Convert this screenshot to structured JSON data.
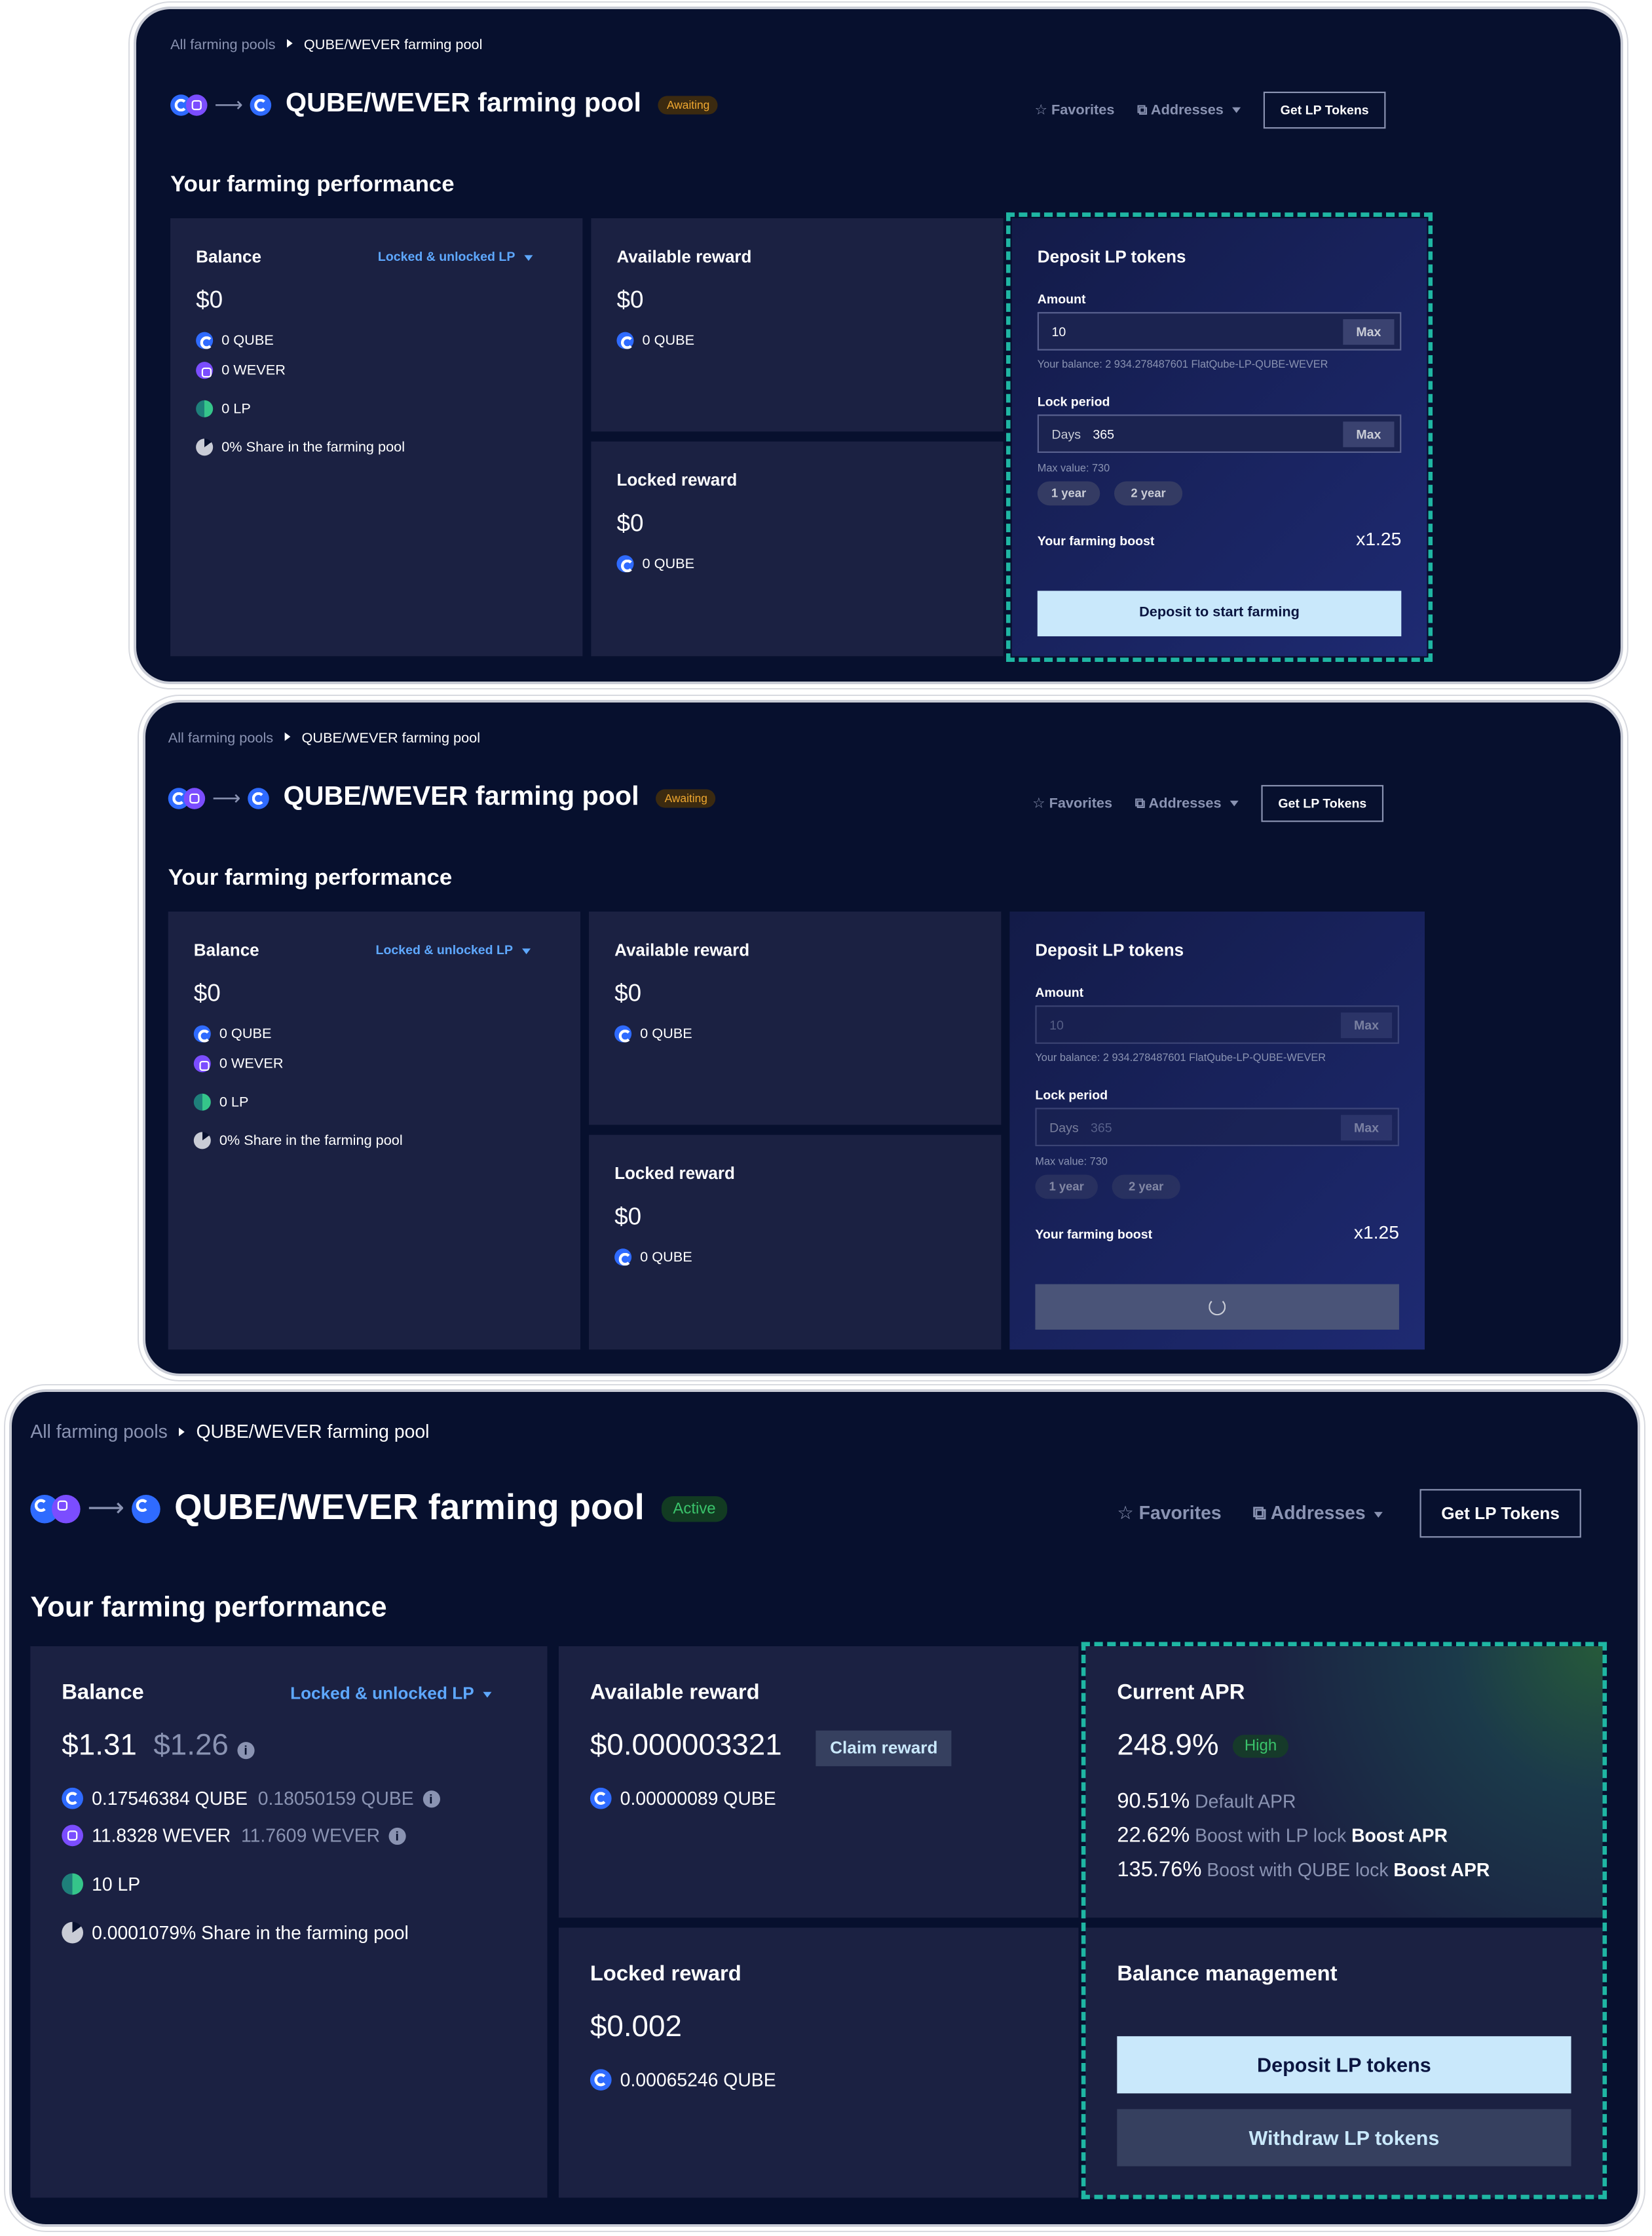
{
  "breadcrumb": {
    "root": "All farming pools",
    "current": "QUBE/WEVER farming pool"
  },
  "pool_title": "QUBE/WEVER farming pool",
  "links": {
    "favorites": "Favorites",
    "addresses": "Addresses",
    "get_lp": "Get LP Tokens"
  },
  "section_title": "Your farming performance",
  "balance": {
    "title": "Balance",
    "filter": "Locked & unlocked LP"
  },
  "rewards": {
    "available_title": "Available reward",
    "locked_title": "Locked reward"
  },
  "deposit": {
    "title": "Deposit LP tokens",
    "amount_label": "Amount",
    "amount_value": "10",
    "max": "Max",
    "your_balance": "Your balance: 2 934.278487601 FlatQube-LP-QUBE-WEVER",
    "lock_label": "Lock period",
    "days_label": "Days",
    "days_value": "365",
    "max_value": "Max value: 730",
    "pill_1": "1 year",
    "pill_2": "2 year",
    "boost_label": "Your farming boost",
    "boost_value": "x1.25",
    "submit": "Deposit to start farming"
  },
  "state_empty": {
    "status": "Awaiting",
    "balance_usd": "$0",
    "qube": "0 QUBE",
    "wever": "0 WEVER",
    "lp": "0 LP",
    "share": "0% Share in the farming pool",
    "available_usd": "$0",
    "available_qube": "0 QUBE",
    "locked_usd": "$0",
    "locked_qube": "0 QUBE"
  },
  "state_active": {
    "status": "Active",
    "balance_usd": "$1.31",
    "balance_usd_prev": "$1.26",
    "qube": "0.17546384 QUBE",
    "qube_prev": "0.18050159 QUBE",
    "wever": "11.8328 WEVER",
    "wever_prev": "11.7609 WEVER",
    "lp": "10 LP",
    "share": "0.0001079% Share in the farming pool",
    "available_usd": "$0.000003321",
    "claim": "Claim reward",
    "available_qube": "0.00000089 QUBE",
    "locked_usd": "$0.002",
    "locked_qube": "0.00065246 QUBE",
    "apr_title": "Current APR",
    "apr_value": "248.9%",
    "apr_badge": "High",
    "apr_default_val": "90.51%",
    "apr_default_lbl": "Default APR",
    "apr_lp_val": "22.62%",
    "apr_lp_lbl": "Boost with LP lock",
    "apr_qube_val": "135.76%",
    "apr_qube_lbl": "Boost with QUBE lock",
    "boost_apr": "Boost APR",
    "mgmt_title": "Balance management",
    "deposit_btn": "Deposit LP tokens",
    "withdraw_btn": "Withdraw LP tokens"
  },
  "icons": [
    "qube-token-icon",
    "wever-token-icon",
    "lp-token-icon",
    "pie-share-icon",
    "star-icon",
    "external-link-icon",
    "chevron-down-icon",
    "info-icon",
    "spinner-icon"
  ],
  "colors": {
    "bg": "#07102e",
    "card": "#1b2142",
    "accent_teal": "#1fb6a3",
    "light_button": "#c9e8fb",
    "awaiting": "#f0a830",
    "active": "#3ac36b"
  }
}
